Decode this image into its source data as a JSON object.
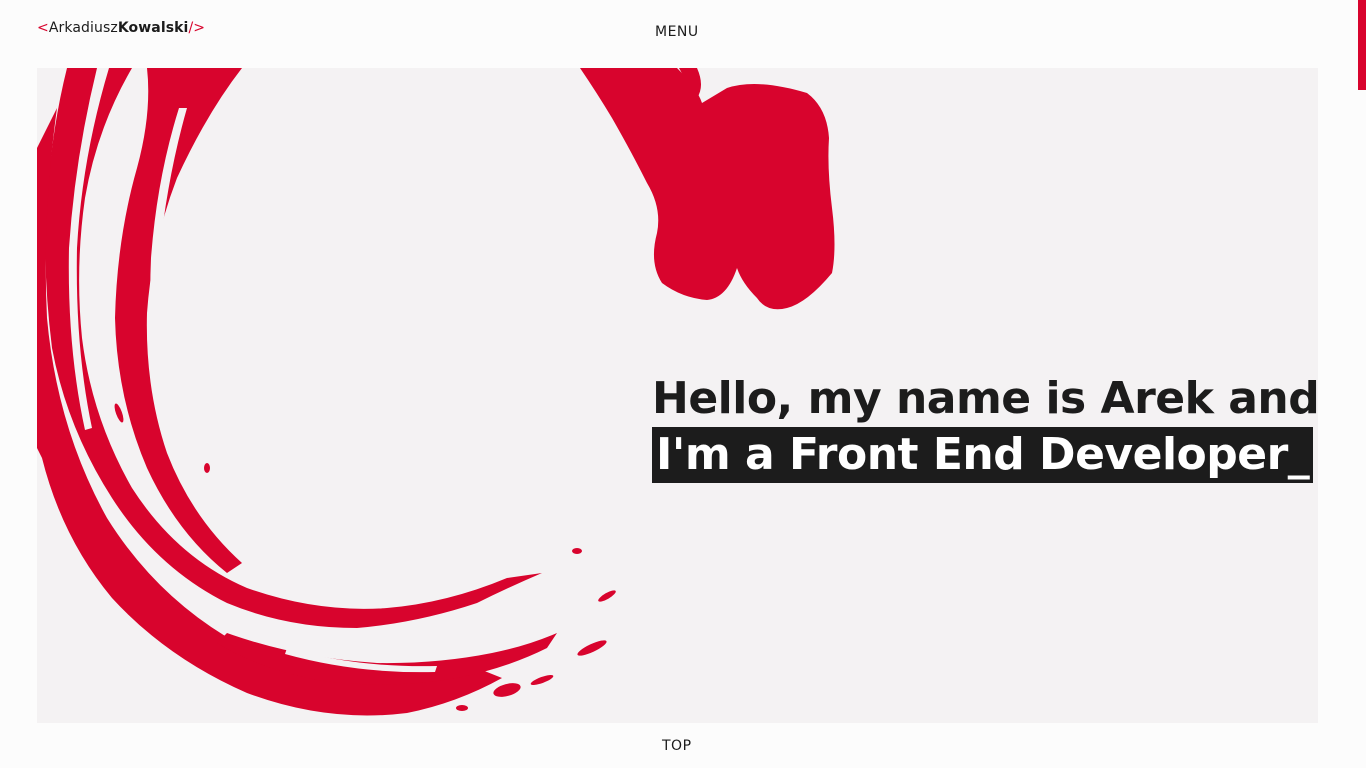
{
  "header": {
    "logo": {
      "open_bracket": "<",
      "first_name": "Arkadiusz",
      "last_name": "Kowalski",
      "close_bracket": "/>"
    },
    "menu_label": "MENU"
  },
  "hero": {
    "headline_line1": "Hello, my name is Arek and",
    "headline_line2": "I'm a Front End Developer_"
  },
  "footer": {
    "top_label": "TOP"
  },
  "colors": {
    "accent": "#d8042d",
    "text": "#1c1c1c",
    "hero_bg": "#f4f2f3",
    "page_bg": "#fcfcfc"
  }
}
